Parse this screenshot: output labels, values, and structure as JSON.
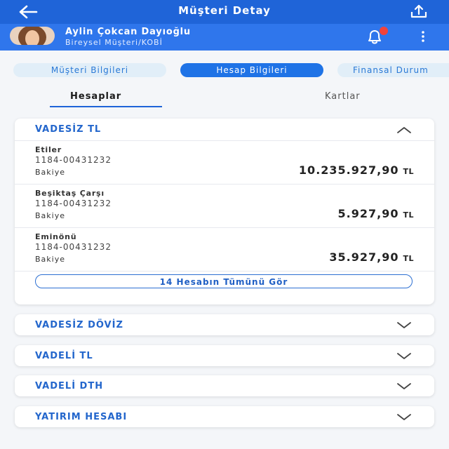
{
  "header": {
    "title": "Müşteri Detay"
  },
  "user": {
    "name": "Aylin Çokcan Dayıoğlu",
    "type": "Bireysel Müşteri/KOBİ"
  },
  "tabs": [
    {
      "label": "Müşteri Bilgileri",
      "active": false
    },
    {
      "label": "Hesap Bilgileri",
      "active": true
    },
    {
      "label": "Finansal Durum",
      "active": false
    }
  ],
  "subtabs": [
    {
      "label": "Hesaplar",
      "active": true
    },
    {
      "label": "Kartlar",
      "active": false
    }
  ],
  "expanded": {
    "title": "VADESİZ TL",
    "accounts": [
      {
        "name": "Etiler",
        "number": "1184-00431232",
        "balance_label": "Bakiye",
        "balance": "10.235.927,90",
        "currency": "TL"
      },
      {
        "name": "Beşiktaş Çarşı",
        "number": "1184-00431232",
        "balance_label": "Bakiye",
        "balance": "5.927,90",
        "currency": "TL"
      },
      {
        "name": "Eminönü",
        "number": "1184-00431232",
        "balance_label": "Bakiye",
        "balance": "35.927,90",
        "currency": "TL"
      }
    ],
    "show_all": "14 Hesabın Tümünü Gör"
  },
  "collapsed": [
    {
      "title": "VADESİZ DÖVİZ"
    },
    {
      "title": "VADELİ TL"
    },
    {
      "title": "VADELİ DTH"
    },
    {
      "title": "YATIRIM HESABI"
    }
  ],
  "colors": {
    "header": "#1f64d8",
    "userbar": "#2f76ec",
    "accent": "#2366cc",
    "badge": "#f2433b"
  },
  "icons": [
    "back-arrow-icon",
    "share-icon",
    "bell-icon",
    "kebab-menu-icon",
    "chevron-up-icon",
    "chevron-down-icon"
  ]
}
